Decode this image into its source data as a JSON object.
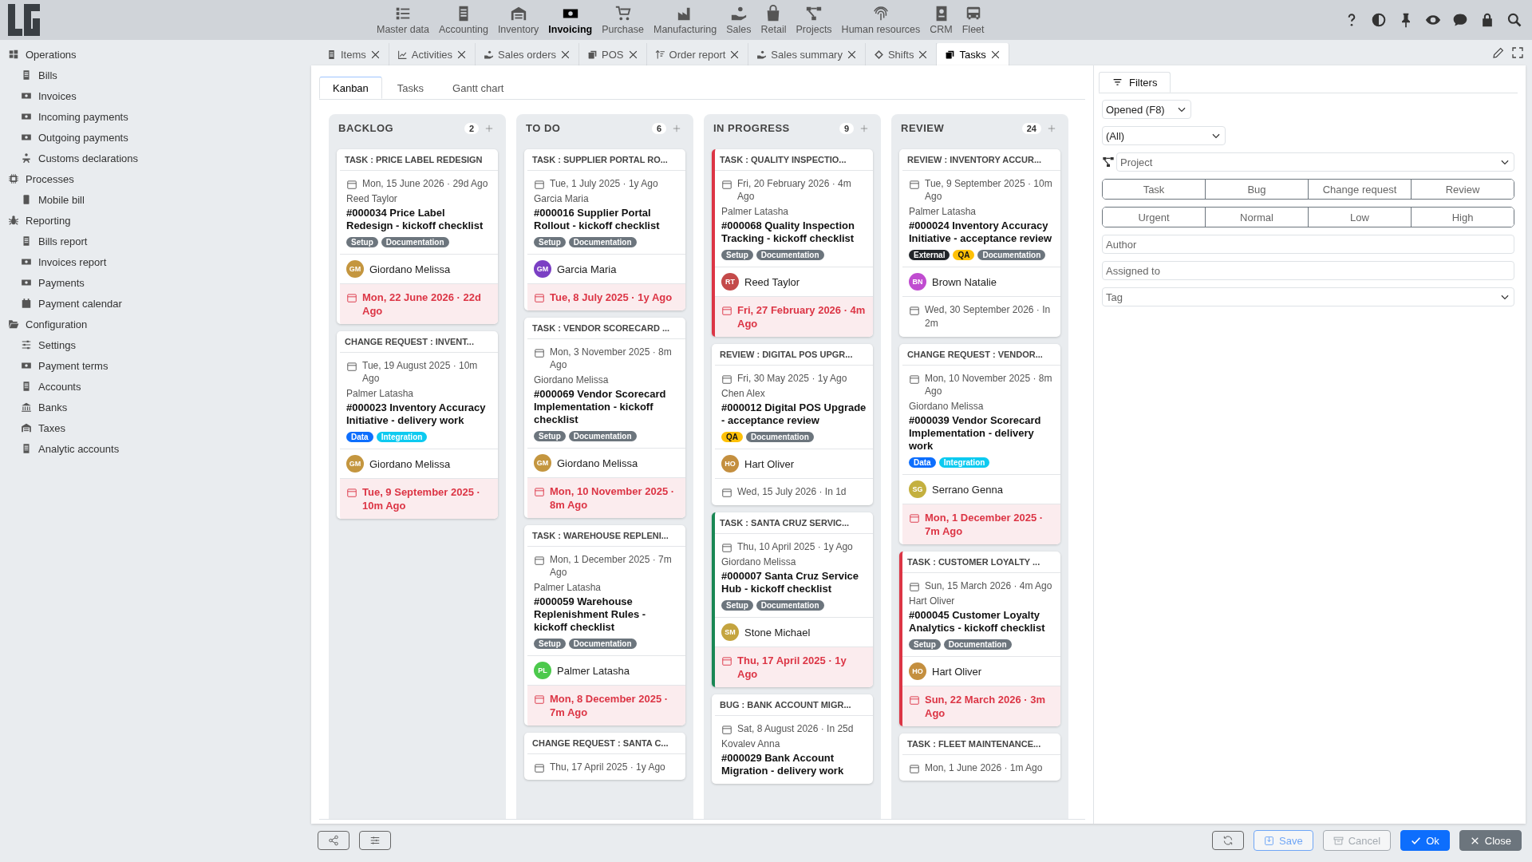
{
  "top_nav": [
    {
      "label": "Master data",
      "selected": false
    },
    {
      "label": "Accounting",
      "selected": false
    },
    {
      "label": "Inventory",
      "selected": false
    },
    {
      "label": "Invoicing",
      "selected": true
    },
    {
      "label": "Purchase",
      "selected": false
    },
    {
      "label": "Manufacturing",
      "selected": false
    },
    {
      "label": "Sales",
      "selected": false
    },
    {
      "label": "Retail",
      "selected": false
    },
    {
      "label": "Projects",
      "selected": false
    },
    {
      "label": "Human resources",
      "selected": false
    },
    {
      "label": "CRM",
      "selected": false
    },
    {
      "label": "Fleet",
      "selected": false
    }
  ],
  "sidebar": {
    "items": [
      {
        "label": "Operations",
        "children": [
          {
            "label": "Bills"
          },
          {
            "label": "Invoices"
          },
          {
            "label": "Incoming payments"
          },
          {
            "label": "Outgoing payments"
          },
          {
            "label": "Customs declarations"
          }
        ]
      },
      {
        "label": "Processes",
        "children": [
          {
            "label": "Mobile bill"
          }
        ]
      },
      {
        "label": "Reporting",
        "children": [
          {
            "label": "Bills report"
          },
          {
            "label": "Invoices report"
          },
          {
            "label": "Payments"
          },
          {
            "label": "Payment calendar"
          }
        ]
      },
      {
        "label": "Configuration",
        "children": [
          {
            "label": "Settings"
          },
          {
            "label": "Payment terms"
          },
          {
            "label": "Accounts"
          },
          {
            "label": "Banks"
          },
          {
            "label": "Taxes"
          },
          {
            "label": "Analytic accounts"
          }
        ]
      }
    ]
  },
  "tabs": [
    {
      "label": "Items",
      "selected": false
    },
    {
      "label": "Activities",
      "selected": false
    },
    {
      "label": "Sales orders",
      "selected": false
    },
    {
      "label": "POS",
      "selected": false
    },
    {
      "label": "Order report",
      "selected": false
    },
    {
      "label": "Sales summary",
      "selected": false
    },
    {
      "label": "Shifts",
      "selected": false
    },
    {
      "label": "Tasks",
      "selected": true
    }
  ],
  "view_tabs": [
    {
      "label": "Kanban",
      "selected": true
    },
    {
      "label": "Tasks",
      "selected": false
    },
    {
      "label": "Gantt chart",
      "selected": false
    }
  ],
  "columns": [
    {
      "title": "BACKLOG",
      "count": "2",
      "cards": [
        {
          "title": "TASK : PRICE LABEL REDESIGN",
          "date": "Mon, 15 June 2026 · 29d Ago",
          "author": "Reed Taylor",
          "name": "#000034 Price Label Redesign - kickoff checklist",
          "tags": [
            {
              "label": "Setup",
              "color": "#6c757d"
            },
            {
              "label": "Documentation",
              "color": "#6c757d"
            }
          ],
          "assignee": {
            "initials": "GM",
            "name": "Giordano Melissa",
            "color": "#c4963f"
          },
          "due": {
            "text": "Mon, 22 June 2026 · 22d Ago",
            "overdue": true
          }
        },
        {
          "title": "CHANGE REQUEST : INVENT...",
          "date": "Tue, 19 August 2025 · 10m Ago",
          "author": "Palmer Latasha",
          "name": "#000023 Inventory Accuracy Initiative - delivery work",
          "tags": [
            {
              "label": "Data",
              "color": "#0d6efd"
            },
            {
              "label": "Integration",
              "color": "#0dcaf0"
            }
          ],
          "assignee": {
            "initials": "GM",
            "name": "Giordano Melissa",
            "color": "#c4963f"
          },
          "due": {
            "text": "Tue, 9 September 2025 · 10m Ago",
            "overdue": true
          }
        }
      ]
    },
    {
      "title": "TO DO",
      "count": "6",
      "cards": [
        {
          "title": "TASK : SUPPLIER PORTAL RO...",
          "date": "Tue, 1 July 2025 · 1y Ago",
          "author": "Garcia Maria",
          "name": "#000016 Supplier Portal Rollout - kickoff checklist",
          "tags": [
            {
              "label": "Setup",
              "color": "#6c757d"
            },
            {
              "label": "Documentation",
              "color": "#6c757d"
            }
          ],
          "assignee": {
            "initials": "GM",
            "name": "Garcia Maria",
            "color": "#7b3fc4"
          },
          "due": {
            "text": "Tue, 8 July 2025 · 1y Ago",
            "overdue": true
          }
        },
        {
          "title": "TASK : VENDOR SCORECARD ...",
          "date": "Mon, 3 November 2025 · 8m Ago",
          "author": "Giordano Melissa",
          "name": "#000069 Vendor Scorecard Implementation - kickoff checklist",
          "tags": [
            {
              "label": "Setup",
              "color": "#6c757d"
            },
            {
              "label": "Documentation",
              "color": "#6c757d"
            }
          ],
          "assignee": {
            "initials": "GM",
            "name": "Giordano Melissa",
            "color": "#c4963f"
          },
          "due": {
            "text": "Mon, 10 November 2025 · 8m Ago",
            "overdue": true
          }
        },
        {
          "title": "TASK : WAREHOUSE REPLENI...",
          "date": "Mon, 1 December 2025 · 7m Ago",
          "author": "Palmer Latasha",
          "name": "#000059 Warehouse Replenishment Rules - kickoff checklist",
          "tags": [
            {
              "label": "Setup",
              "color": "#6c757d"
            },
            {
              "label": "Documentation",
              "color": "#6c757d"
            }
          ],
          "assignee": {
            "initials": "PL",
            "name": "Palmer Latasha",
            "color": "#4cc94c"
          },
          "due": {
            "text": "Mon, 8 December 2025 · 7m Ago",
            "overdue": true
          }
        },
        {
          "title": "CHANGE REQUEST : SANTA C...",
          "date": "Thu, 17 April 2025 · 1y Ago"
        }
      ]
    },
    {
      "title": "IN PROGRESS",
      "count": "9",
      "cards": [
        {
          "title": "TASK : QUALITY INSPECTIO...",
          "color": "#dc3545",
          "date": "Fri, 20 February 2026 · 4m Ago",
          "author": "Palmer Latasha",
          "name": "#000068 Quality Inspection Tracking - kickoff checklist",
          "tags": [
            {
              "label": "Setup",
              "color": "#6c757d"
            },
            {
              "label": "Documentation",
              "color": "#6c757d"
            }
          ],
          "assignee": {
            "initials": "RT",
            "name": "Reed Taylor",
            "color": "#c44a4a"
          },
          "due": {
            "text": "Fri, 27 February 2026 · 4m Ago",
            "overdue": true
          }
        },
        {
          "title": "REVIEW : DIGITAL POS UPGR...",
          "date": "Fri, 30 May 2025 · 1y Ago",
          "author": "Chen Alex",
          "name": "#000012 Digital POS Upgrade - acceptance review",
          "tags": [
            {
              "label": "QA",
              "color": "#ffc107"
            },
            {
              "label": "Documentation",
              "color": "#6c757d"
            }
          ],
          "assignee": {
            "initials": "HO",
            "name": "Hart Oliver",
            "color": "#c48f3f"
          },
          "due": {
            "text": "Wed, 15 July 2026 · In 1d",
            "overdue": false
          }
        },
        {
          "title": "TASK : SANTA CRUZ SERVIC...",
          "color": "#198754",
          "date": "Thu, 10 April 2025 · 1y Ago",
          "author": "Giordano Melissa",
          "name": "#000007 Santa Cruz Service Hub - kickoff checklist",
          "tags": [
            {
              "label": "Setup",
              "color": "#6c757d"
            },
            {
              "label": "Documentation",
              "color": "#6c757d"
            }
          ],
          "assignee": {
            "initials": "SM",
            "name": "Stone Michael",
            "color": "#c4a43f"
          },
          "due": {
            "text": "Thu, 17 April 2025 · 1y Ago",
            "overdue": true
          }
        },
        {
          "title": "BUG : BANK ACCOUNT MIGR...",
          "date": "Sat, 8 August 2026 · In 25d",
          "author": "Kovalev Anna",
          "name": "#000029 Bank Account Migration - delivery work"
        }
      ]
    },
    {
      "title": "REVIEW",
      "count": "24",
      "cards": [
        {
          "title": "REVIEW : INVENTORY ACCUR...",
          "date": "Tue, 9 September 2025 · 10m Ago",
          "author": "Palmer Latasha",
          "name": "#000024 Inventory Accuracy Initiative - acceptance review",
          "tags": [
            {
              "label": "External",
              "color": "#212529"
            },
            {
              "label": "QA",
              "color": "#ffc107"
            },
            {
              "label": "Documentation",
              "color": "#6c757d"
            }
          ],
          "assignee": {
            "initials": "BN",
            "name": "Brown Natalie",
            "color": "#c04cd0"
          },
          "due": {
            "text": "Wed, 30 September 2026 · In 2m",
            "overdue": false
          }
        },
        {
          "title": "CHANGE REQUEST : VENDOR...",
          "date": "Mon, 10 November 2025 · 8m Ago",
          "author": "Giordano Melissa",
          "name": "#000039 Vendor Scorecard Implementation - delivery work",
          "tags": [
            {
              "label": "Data",
              "color": "#0d6efd"
            },
            {
              "label": "Integration",
              "color": "#0dcaf0"
            }
          ],
          "assignee": {
            "initials": "SG",
            "name": "Serrano Genna",
            "color": "#c4b03f"
          },
          "due": {
            "text": "Mon, 1 December 2025 · 7m Ago",
            "overdue": true
          }
        },
        {
          "title": "TASK : CUSTOMER LOYALTY ...",
          "color": "#dc3545",
          "date": "Sun, 15 March 2026 · 4m Ago",
          "author": "Hart Oliver",
          "name": "#000045 Customer Loyalty Analytics - kickoff checklist",
          "tags": [
            {
              "label": "Setup",
              "color": "#6c757d"
            },
            {
              "label": "Documentation",
              "color": "#6c757d"
            }
          ],
          "assignee": {
            "initials": "HO",
            "name": "Hart Oliver",
            "color": "#c48f3f"
          },
          "due": {
            "text": "Sun, 22 March 2026 · 3m Ago",
            "overdue": true
          }
        },
        {
          "title": "TASK : FLEET MAINTENANCE...",
          "date": "Mon, 1 June 2026 · 1m Ago"
        }
      ]
    }
  ],
  "filters": {
    "tab": "Filters",
    "status": "Opened (F8)",
    "scope": "(All)",
    "project": {
      "placeholder": "Project"
    },
    "types": [
      {
        "label": "Task",
        "selected": false
      },
      {
        "label": "Bug",
        "selected": false
      },
      {
        "label": "Change request",
        "selected": false
      },
      {
        "label": "Review",
        "selected": false
      }
    ],
    "priorities": [
      {
        "label": "Urgent",
        "selected": false
      },
      {
        "label": "Normal",
        "selected": false
      },
      {
        "label": "Low",
        "selected": false
      },
      {
        "label": "High",
        "selected": false
      }
    ],
    "author": {
      "placeholder": "Author"
    },
    "assigned_to": {
      "placeholder": "Assigned to"
    },
    "tag": {
      "placeholder": "Tag"
    }
  },
  "buttons": [
    {
      "label": "Save",
      "kind": "outline-primary",
      "disabled": true
    },
    {
      "label": "Cancel",
      "kind": "outline",
      "disabled": true
    },
    {
      "label": "Ok",
      "kind": "primary",
      "disabled": false
    },
    {
      "label": "Close",
      "kind": "secondary",
      "disabled": false
    }
  ]
}
